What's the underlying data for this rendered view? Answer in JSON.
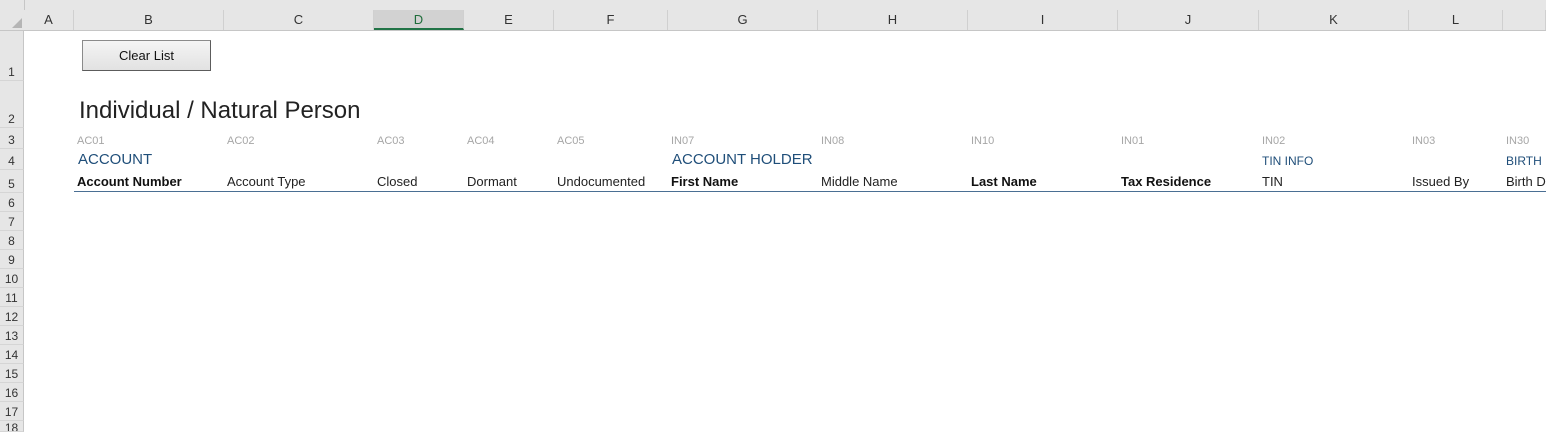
{
  "columns": [
    "A",
    "B",
    "C",
    "D",
    "E",
    "F",
    "G",
    "H",
    "I",
    "J",
    "K",
    "L"
  ],
  "rows": [
    "1",
    "2",
    "3",
    "4",
    "5",
    "6",
    "7",
    "8",
    "9",
    "10",
    "11",
    "12",
    "13",
    "14",
    "15",
    "16",
    "17",
    "18"
  ],
  "selected_column": "D",
  "button": {
    "label": "Clear List"
  },
  "title": "Individual / Natural Person",
  "codes": [
    "AC01",
    "AC02",
    "AC03",
    "AC04",
    "AC05",
    "IN07",
    "IN08",
    "IN10",
    "IN01",
    "IN02",
    "IN03",
    "IN30"
  ],
  "groups": {
    "account": "ACCOUNT",
    "account_holder": "ACCOUNT HOLDER",
    "tin_info": "TIN INFO",
    "birth": "BIRTH I"
  },
  "fields": [
    {
      "label": "Account Number",
      "bold": true
    },
    {
      "label": "Account Type",
      "bold": false
    },
    {
      "label": "Closed",
      "bold": false
    },
    {
      "label": "Dormant",
      "bold": false
    },
    {
      "label": "Undocumented",
      "bold": false
    },
    {
      "label": "First Name",
      "bold": true
    },
    {
      "label": "Middle Name",
      "bold": false
    },
    {
      "label": "Last Name",
      "bold": true
    },
    {
      "label": "Tax Residence",
      "bold": true
    },
    {
      "label": "TIN",
      "bold": false
    },
    {
      "label": "Issued By",
      "bold": false
    },
    {
      "label": "Birth D",
      "bold": false
    }
  ],
  "colors": {
    "group_text": "#1f4e79",
    "selected_col": "#217346",
    "code_text": "#a6a6a6"
  }
}
